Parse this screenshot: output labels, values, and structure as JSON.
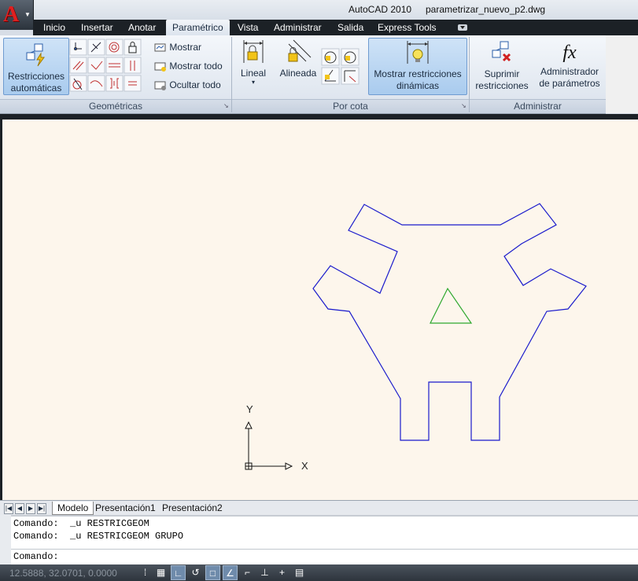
{
  "window": {
    "app_name": "AutoCAD 2010",
    "file_name": "parametrizar_nuevo_p2.dwg"
  },
  "ribbon_tabs": [
    {
      "label": "Inicio"
    },
    {
      "label": "Insertar"
    },
    {
      "label": "Anotar"
    },
    {
      "label": "Paramétrico",
      "active": true
    },
    {
      "label": "Vista"
    },
    {
      "label": "Administrar"
    },
    {
      "label": "Salida"
    },
    {
      "label": "Express Tools"
    }
  ],
  "panels": {
    "geometricas": {
      "title": "Geométricas",
      "big_button": "Restricciones\nautomáticas",
      "small_buttons": [
        "Mostrar",
        "Mostrar todo",
        "Ocultar todo"
      ]
    },
    "por_cota": {
      "title": "Por cota",
      "lineal": "Lineal",
      "alineada": "Alineada",
      "mostrar_dinamicas": "Mostrar restricciones\ndinámicas"
    },
    "administrar": {
      "title": "Administrar",
      "suprimir": "Suprimir\nrestricciones",
      "admin_param": "Administrador\nde parámetros"
    }
  },
  "ucs": {
    "x_label": "X",
    "y_label": "Y"
  },
  "layout_tabs": [
    {
      "label": "Modelo",
      "active": true
    },
    {
      "label": "Presentación1"
    },
    {
      "label": "Presentación2"
    }
  ],
  "command_history": [
    "Comando:  _u RESTRICGEOM",
    "Comando:  _u RESTRICGEOM GRUPO"
  ],
  "command_prompt": "Comando:",
  "status": {
    "coordinates": "12.5888, 32.0701, 0.0000"
  },
  "colors": {
    "drawing_background": "#fdf6ec",
    "shape_outline": "#1a1acc",
    "triangle": "#2ea82e"
  }
}
